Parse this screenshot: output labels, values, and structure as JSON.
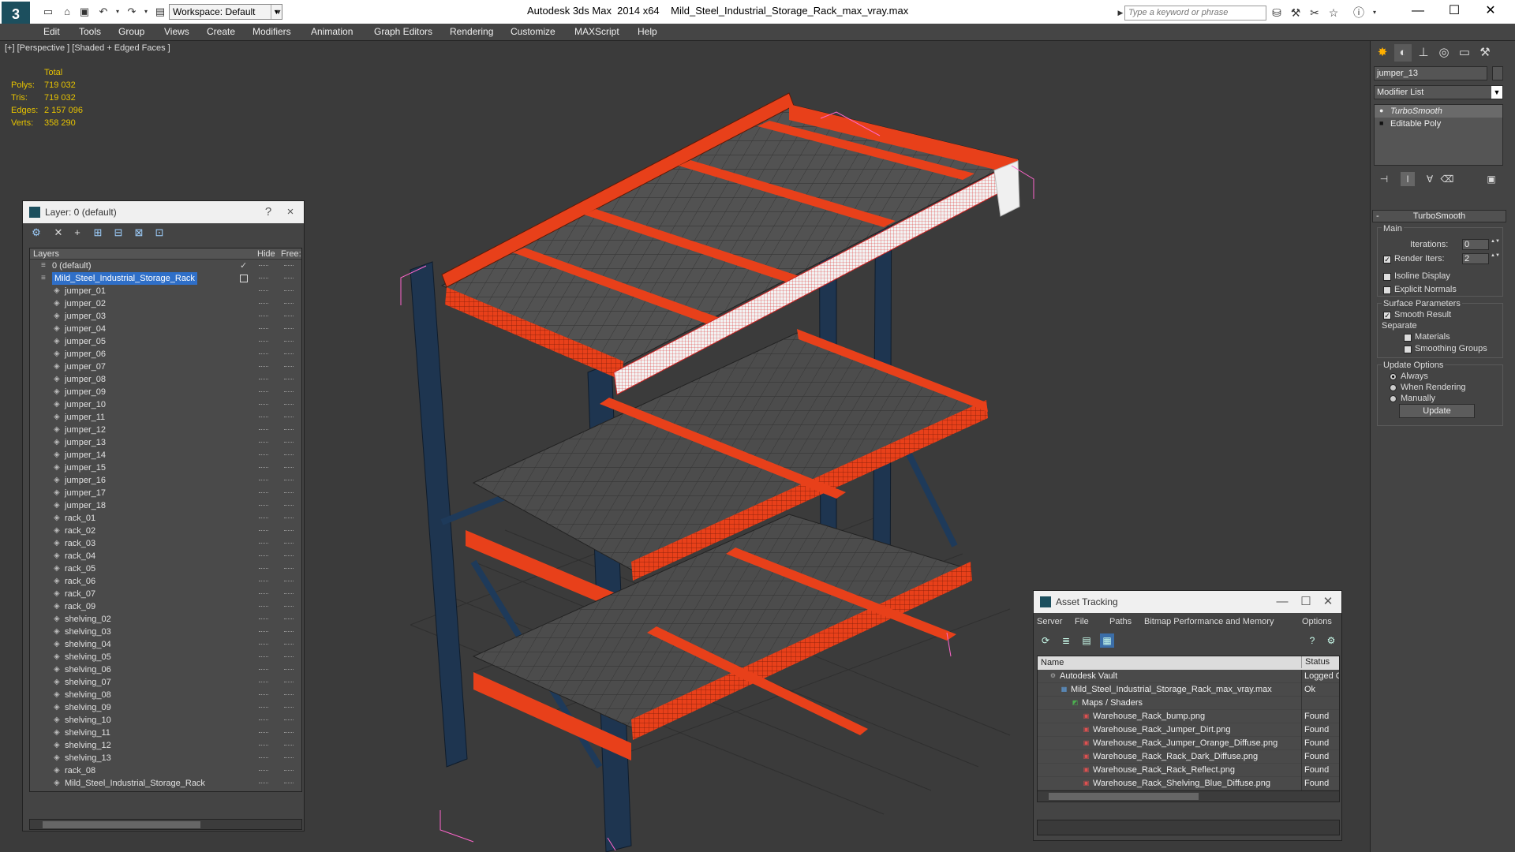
{
  "titlebar": {
    "workspace": "Workspace: Default",
    "app_title": "Autodesk 3ds Max  2014 x64",
    "file_name": "Mild_Steel_Industrial_Storage_Rack_max_vray.max",
    "search_placeholder": "Type a keyword or phrase"
  },
  "menu": [
    "Edit",
    "Tools",
    "Group",
    "Views",
    "Create",
    "Modifiers",
    "Animation",
    "Graph Editors",
    "Rendering",
    "Customize",
    "MAXScript",
    "Help"
  ],
  "viewport": {
    "label": "[+] [Perspective ] [Shaded + Edged Faces ]",
    "stats": {
      "header": "Total",
      "rows": [
        {
          "k": "Polys:",
          "v": "719 032"
        },
        {
          "k": "Tris:",
          "v": "719 032"
        },
        {
          "k": "Edges:",
          "v": "2 157 096"
        },
        {
          "k": "Verts:",
          "v": "358 290"
        }
      ]
    },
    "colors": {
      "background": "#3b3b3b",
      "beam": "#e8401a",
      "upright": "#1e3550",
      "shelf": "#555555",
      "grid": "#2f2f2f",
      "selection": "#ff66cc"
    }
  },
  "layer_panel": {
    "title": "Layer: 0 (default)",
    "help": "?",
    "close": "×",
    "headers": {
      "layers": "Layers",
      "hide": "Hide",
      "freeze": "Free:"
    },
    "layers": [
      {
        "name": "0 (default)",
        "level": 0,
        "type": "layer",
        "check": "✓"
      },
      {
        "name": "Mild_Steel_Industrial_Storage_Rack",
        "level": 0,
        "type": "layer",
        "selected": true
      },
      {
        "name": "jumper_01",
        "level": 1,
        "type": "object"
      },
      {
        "name": "jumper_02",
        "level": 1,
        "type": "object"
      },
      {
        "name": "jumper_03",
        "level": 1,
        "type": "object"
      },
      {
        "name": "jumper_04",
        "level": 1,
        "type": "object"
      },
      {
        "name": "jumper_05",
        "level": 1,
        "type": "object"
      },
      {
        "name": "jumper_06",
        "level": 1,
        "type": "object"
      },
      {
        "name": "jumper_07",
        "level": 1,
        "type": "object"
      },
      {
        "name": "jumper_08",
        "level": 1,
        "type": "object"
      },
      {
        "name": "jumper_09",
        "level": 1,
        "type": "object"
      },
      {
        "name": "jumper_10",
        "level": 1,
        "type": "object"
      },
      {
        "name": "jumper_11",
        "level": 1,
        "type": "object"
      },
      {
        "name": "jumper_12",
        "level": 1,
        "type": "object"
      },
      {
        "name": "jumper_13",
        "level": 1,
        "type": "object"
      },
      {
        "name": "jumper_14",
        "level": 1,
        "type": "object"
      },
      {
        "name": "jumper_15",
        "level": 1,
        "type": "object"
      },
      {
        "name": "jumper_16",
        "level": 1,
        "type": "object"
      },
      {
        "name": "jumper_17",
        "level": 1,
        "type": "object"
      },
      {
        "name": "jumper_18",
        "level": 1,
        "type": "object"
      },
      {
        "name": "rack_01",
        "level": 1,
        "type": "object"
      },
      {
        "name": "rack_02",
        "level": 1,
        "type": "object"
      },
      {
        "name": "rack_03",
        "level": 1,
        "type": "object"
      },
      {
        "name": "rack_04",
        "level": 1,
        "type": "object"
      },
      {
        "name": "rack_05",
        "level": 1,
        "type": "object"
      },
      {
        "name": "rack_06",
        "level": 1,
        "type": "object"
      },
      {
        "name": "rack_07",
        "level": 1,
        "type": "object"
      },
      {
        "name": "rack_09",
        "level": 1,
        "type": "object"
      },
      {
        "name": "shelving_02",
        "level": 1,
        "type": "object"
      },
      {
        "name": "shelving_03",
        "level": 1,
        "type": "object"
      },
      {
        "name": "shelving_04",
        "level": 1,
        "type": "object"
      },
      {
        "name": "shelving_05",
        "level": 1,
        "type": "object"
      },
      {
        "name": "shelving_06",
        "level": 1,
        "type": "object"
      },
      {
        "name": "shelving_07",
        "level": 1,
        "type": "object"
      },
      {
        "name": "shelving_08",
        "level": 1,
        "type": "object"
      },
      {
        "name": "shelving_09",
        "level": 1,
        "type": "object"
      },
      {
        "name": "shelving_10",
        "level": 1,
        "type": "object"
      },
      {
        "name": "shelving_11",
        "level": 1,
        "type": "object"
      },
      {
        "name": "shelving_12",
        "level": 1,
        "type": "object"
      },
      {
        "name": "shelving_13",
        "level": 1,
        "type": "object"
      },
      {
        "name": "rack_08",
        "level": 1,
        "type": "object"
      },
      {
        "name": "Mild_Steel_Industrial_Storage_Rack",
        "level": 1,
        "type": "object"
      }
    ]
  },
  "asset_panel": {
    "title": "Asset Tracking",
    "menu": [
      "Server",
      "File",
      "Paths",
      "Bitmap Performance and Memory",
      "Options"
    ],
    "headers": {
      "name": "Name",
      "status": "Status"
    },
    "rows": [
      {
        "name": "Autodesk Vault",
        "status": "Logged O",
        "level": 0,
        "icon": "vault-icon"
      },
      {
        "name": "Mild_Steel_Industrial_Storage_Rack_max_vray.max",
        "status": "Ok",
        "level": 1,
        "icon": "max-file-icon"
      },
      {
        "name": "Maps / Shaders",
        "status": "",
        "level": 2,
        "icon": "maps-icon"
      },
      {
        "name": "Warehouse_Rack_bump.png",
        "status": "Found",
        "level": 3,
        "icon": "png-icon"
      },
      {
        "name": "Warehouse_Rack_Jumper_Dirt.png",
        "status": "Found",
        "level": 3,
        "icon": "png-icon"
      },
      {
        "name": "Warehouse_Rack_Jumper_Orange_Diffuse.png",
        "status": "Found",
        "level": 3,
        "icon": "png-icon"
      },
      {
        "name": "Warehouse_Rack_Rack_Dark_Diffuse.png",
        "status": "Found",
        "level": 3,
        "icon": "png-icon"
      },
      {
        "name": "Warehouse_Rack_Rack_Reflect.png",
        "status": "Found",
        "level": 3,
        "icon": "png-icon"
      },
      {
        "name": "Warehouse_Rack_Shelving_Blue_Diffuse.png",
        "status": "Found",
        "level": 3,
        "icon": "png-icon"
      }
    ]
  },
  "command_panel": {
    "object_name": "jumper_13",
    "modifier_list": "Modifier List",
    "stack": [
      {
        "name": "TurboSmooth",
        "active": true
      },
      {
        "name": "Editable Poly",
        "active": false
      }
    ],
    "turbosmooth": {
      "title": "TurboSmooth",
      "main_label": "Main",
      "iterations_label": "Iterations:",
      "iterations": "0",
      "render_iters_label": "Render Iters:",
      "render_iters": "2",
      "render_iters_checked": true,
      "isoline_label": "Isoline Display",
      "isoline_checked": false,
      "explicit_normals_label": "Explicit Normals",
      "explicit_checked": false,
      "surface_label": "Surface Parameters",
      "smooth_result_label": "Smooth Result",
      "smooth_result_checked": true,
      "separate_label": "Separate",
      "materials_label": "Materials",
      "materials_checked": false,
      "smoothing_groups_label": "Smoothing Groups",
      "smoothing_groups_checked": false,
      "update_options_label": "Update Options",
      "always_label": "Always",
      "when_rendering_label": "When Rendering",
      "manually_label": "Manually",
      "selected_option": "Always",
      "update_button": "Update"
    }
  }
}
